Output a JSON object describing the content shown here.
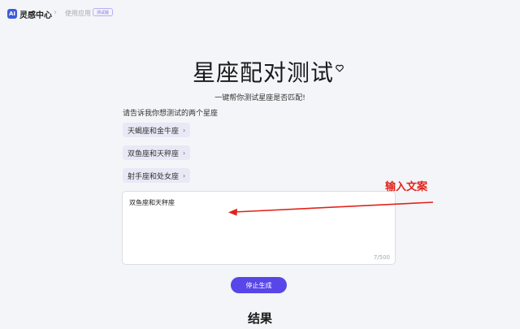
{
  "header": {
    "logo_icon_text": "AI",
    "logo_text": "灵感中心",
    "separator": "›",
    "breadcrumb_app": "使用应用",
    "breadcrumb_badge": "测试版"
  },
  "main": {
    "title": "星座配对测试",
    "subtitle": "一键帮你测试星座是否匹配!",
    "prompt_label": "请告诉我你想测试的两个星座",
    "suggestions": [
      {
        "label": "天蝎座和金牛座"
      },
      {
        "label": "双鱼座和天秤座"
      },
      {
        "label": "射手座和处女座"
      }
    ],
    "chip_chevron": "›",
    "input": {
      "value": "双鱼座和天秤座",
      "char_count": "7/500"
    },
    "stop_button_label": "停止生成",
    "result_heading": "结果"
  },
  "annotation": {
    "label": "输入文案",
    "color": "#e2231a"
  },
  "colors": {
    "accent": "#5846e8",
    "chip_bg": "#e8e8f6",
    "page_bg": "#f4f5f8"
  }
}
